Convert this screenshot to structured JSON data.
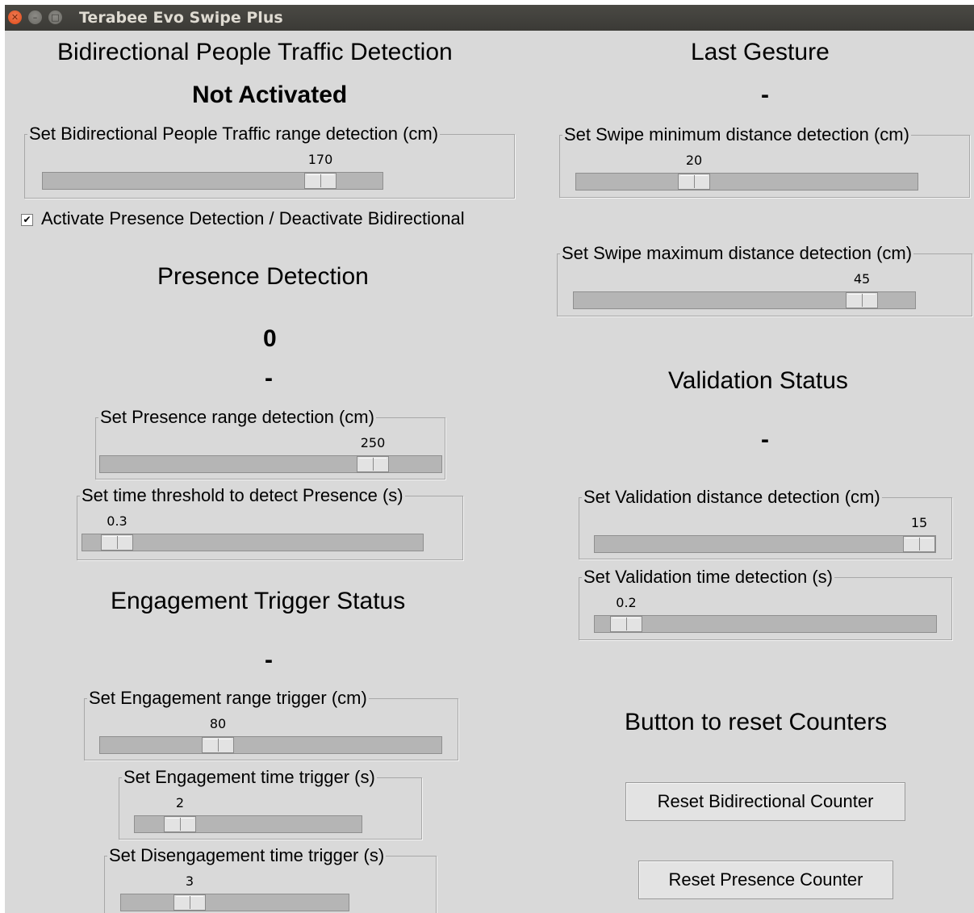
{
  "window": {
    "title": "Terabee Evo Swipe Plus"
  },
  "left": {
    "bidirectional_heading": "Bidirectional People Traffic Detection",
    "bidirectional_status": "Not Activated",
    "bidirectional_range": {
      "caption": "Set Bidirectional People Traffic range detection (cm)",
      "value": "170",
      "fraction": 0.85
    },
    "presence_checkbox": {
      "label": "Activate Presence Detection / Deactivate Bidirectional",
      "checked": true,
      "mark": "✔"
    },
    "presence_heading": "Presence Detection",
    "presence_count": "0",
    "presence_status": "-",
    "presence_range": {
      "caption": "Set Presence range detection (cm)",
      "value": "250",
      "fraction": 0.83
    },
    "presence_time": {
      "caption": "Set time threshold to detect Presence (s)",
      "value": "0.3",
      "fraction": 0.06
    },
    "engagement_heading": "Engagement Trigger Status",
    "engagement_status": "-",
    "engagement_range": {
      "caption": "Set Engagement range trigger (cm)",
      "value": "80",
      "fraction": 0.33
    },
    "engagement_time": {
      "caption": "Set Engagement time trigger (s)",
      "value": "2",
      "fraction": 0.15
    },
    "disengagement_time": {
      "caption": "Set Disengagement time trigger (s)",
      "value": "3",
      "fraction": 0.27
    }
  },
  "right": {
    "gesture_heading": "Last Gesture",
    "gesture_status": "-",
    "swipe_min": {
      "caption": "Set Swipe minimum distance detection (cm)",
      "value": "20",
      "fraction": 0.33
    },
    "swipe_max": {
      "caption": "Set Swipe maximum distance detection (cm)",
      "value": "45",
      "fraction": 0.88
    },
    "validation_heading": "Validation Status",
    "validation_status": "-",
    "validation_distance": {
      "caption": "Set Validation distance detection (cm)",
      "value": "15",
      "fraction": 1.0
    },
    "validation_time": {
      "caption": "Set Validation time detection (s)",
      "value": "0.2",
      "fraction": 0.05
    },
    "reset_heading": "Button to reset Counters",
    "reset_bidirectional_label": "Reset Bidirectional Counter",
    "reset_presence_label": "Reset Presence Counter"
  },
  "colors": {
    "titlebar": "#3c3b37",
    "background": "#d9d9d9",
    "trough": "#b5b5b5",
    "close": "#df4a16"
  }
}
